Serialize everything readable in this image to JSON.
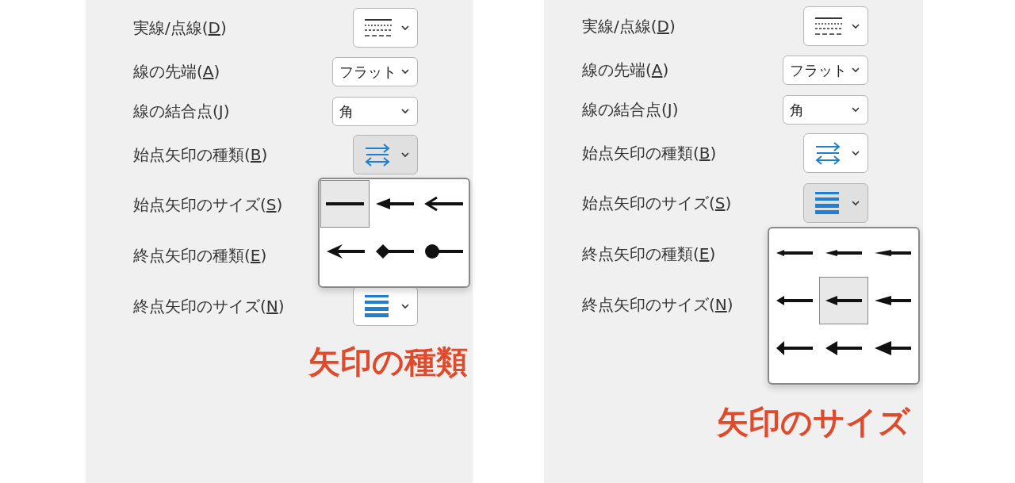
{
  "panels": [
    {
      "rows": [
        {
          "label_before": "実線/点線(",
          "mnemonic": "D",
          "label_after": ")",
          "control": {
            "kind": "line_style",
            "pressed": false
          }
        },
        {
          "label_before": "線の先端(",
          "mnemonic": "A",
          "label_after": ")",
          "control": {
            "kind": "select",
            "value": "フラット"
          }
        },
        {
          "label_before": "線の結合点(",
          "mnemonic": "J",
          "label_after": ")",
          "control": {
            "kind": "select",
            "value": "角"
          }
        },
        {
          "label_before": "始点矢印の種類(",
          "mnemonic": "B",
          "label_after": ")",
          "control": {
            "kind": "arrow_type",
            "pressed": true
          }
        },
        {
          "label_before": "始点矢印のサイズ(",
          "mnemonic": "S",
          "label_after": ")"
        },
        {
          "label_before": "終点矢印の種類(",
          "mnemonic": "E",
          "label_after": ")"
        },
        {
          "label_before": "終点矢印のサイズ(",
          "mnemonic": "N",
          "label_after": ")",
          "control": {
            "kind": "arrow_size",
            "pressed": false
          }
        }
      ],
      "popup": {
        "kind": "arrow_type",
        "items": [
          {
            "kind": "none",
            "selected": true
          },
          {
            "kind": "triangle",
            "selected": false
          },
          {
            "kind": "open",
            "selected": false
          },
          {
            "kind": "stealth",
            "selected": false
          },
          {
            "kind": "diamond",
            "selected": false
          },
          {
            "kind": "oval",
            "selected": false
          }
        ]
      },
      "caption": "矢印の種類"
    },
    {
      "rows": [
        {
          "label_before": "実線/点線(",
          "mnemonic": "D",
          "label_after": ")",
          "control": {
            "kind": "line_style",
            "pressed": false
          }
        },
        {
          "label_before": "線の先端(",
          "mnemonic": "A",
          "label_after": ")",
          "control": {
            "kind": "select",
            "value": "フラット"
          }
        },
        {
          "label_before": "線の結合点(",
          "mnemonic": "J",
          "label_after": ")",
          "control": {
            "kind": "select",
            "value": "角"
          }
        },
        {
          "label_before": "始点矢印の種類(",
          "mnemonic": "B",
          "label_after": ")",
          "control": {
            "kind": "arrow_type",
            "pressed": false
          }
        },
        {
          "label_before": "始点矢印のサイズ(",
          "mnemonic": "S",
          "label_after": ")",
          "control": {
            "kind": "arrow_size",
            "pressed": true
          }
        },
        {
          "label_before": "終点矢印の種類(",
          "mnemonic": "E",
          "label_after": ")"
        },
        {
          "label_before": "終点矢印のサイズ(",
          "mnemonic": "N",
          "label_after": ")"
        }
      ],
      "popup": {
        "kind": "arrow_size",
        "items": [
          {
            "kind": "narrow_short",
            "selected": false
          },
          {
            "kind": "narrow_medium",
            "selected": false
          },
          {
            "kind": "narrow_long",
            "selected": false
          },
          {
            "kind": "medium_short",
            "selected": false
          },
          {
            "kind": "medium_medium",
            "selected": true
          },
          {
            "kind": "medium_long",
            "selected": false
          },
          {
            "kind": "wide_short",
            "selected": false
          },
          {
            "kind": "wide_medium",
            "selected": false
          },
          {
            "kind": "wide_long",
            "selected": false
          }
        ]
      },
      "caption": "矢印のサイズ"
    }
  ]
}
